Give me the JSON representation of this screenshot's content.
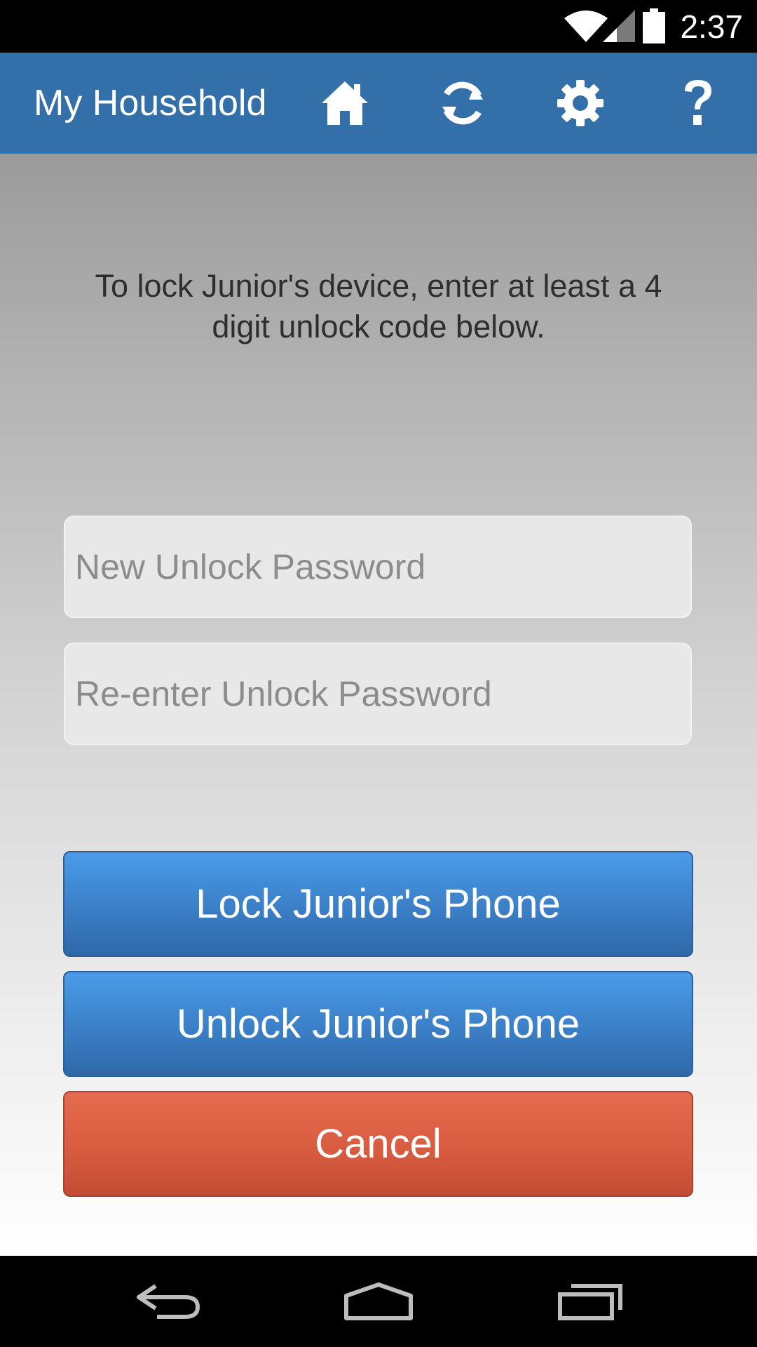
{
  "status_bar": {
    "time": "2:37"
  },
  "app_bar": {
    "title": "My Household",
    "icons": [
      "home-icon",
      "refresh-icon",
      "gear-icon",
      "help-icon"
    ]
  },
  "main": {
    "instruction": "To lock Junior's device, enter at least a 4 digit unlock code below.",
    "new_password": {
      "placeholder": "New Unlock Password",
      "value": ""
    },
    "reenter_password": {
      "placeholder": "Re-enter Unlock Password",
      "value": ""
    },
    "lock_button": "Lock Junior's Phone",
    "unlock_button": "Unlock Junior's Phone",
    "cancel_button": "Cancel"
  },
  "nav_bar": {
    "icons": [
      "back-icon",
      "home-nav-icon",
      "recents-icon"
    ]
  },
  "colors": {
    "app_bar": "#336fa8",
    "primary_button": "#3b7fc7",
    "cancel_button": "#d85c40"
  }
}
